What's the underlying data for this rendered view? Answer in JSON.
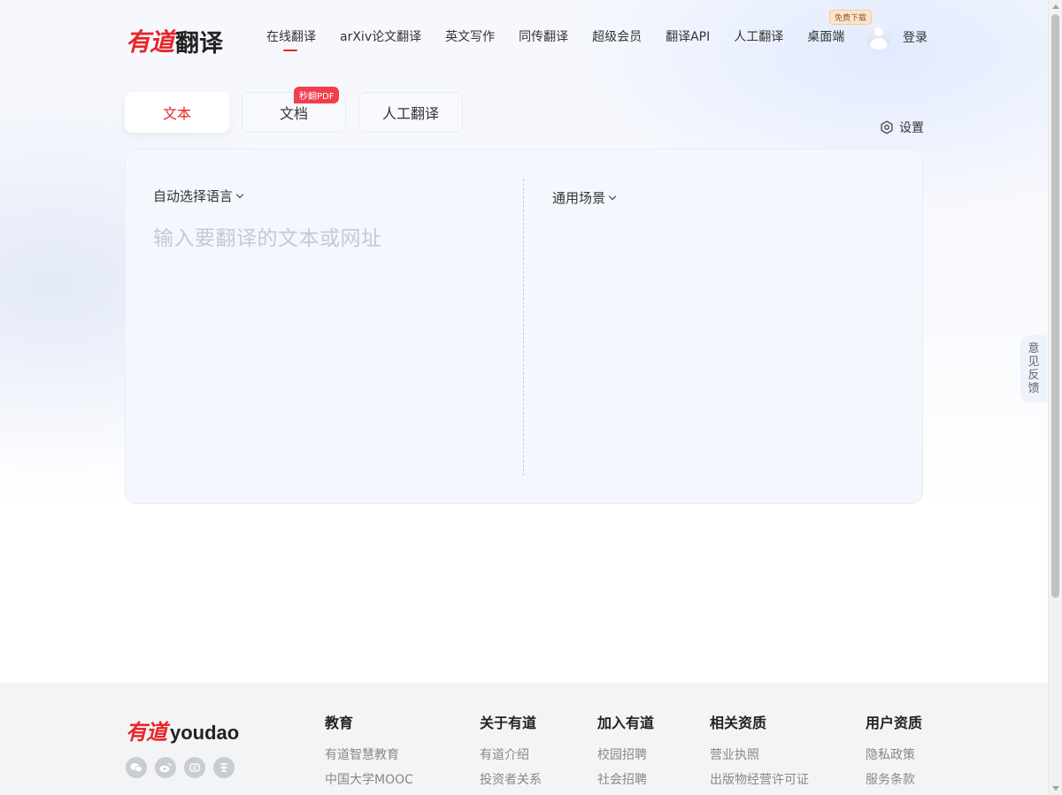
{
  "header": {
    "logo_cn": "有道",
    "logo_title": "翻译",
    "nav": [
      {
        "label": "在线翻译"
      },
      {
        "label": "arXiv论文翻译"
      },
      {
        "label": "英文写作"
      },
      {
        "label": "同传翻译"
      },
      {
        "label": "超级会员"
      },
      {
        "label": "翻译API"
      },
      {
        "label": "人工翻译"
      },
      {
        "label": "桌面端"
      }
    ],
    "desktop_badge": "免费下载",
    "login": "登录"
  },
  "tabs": [
    {
      "label": "文本"
    },
    {
      "label": "文档"
    },
    {
      "label": "人工翻译"
    }
  ],
  "tab_badge": "秒翻PDF",
  "settings_label": "设置",
  "translator": {
    "source_lang": "自动选择语言",
    "scene": "通用场景",
    "placeholder": "输入要翻译的文本或网址"
  },
  "feedback": [
    "意",
    "见",
    "反",
    "馈"
  ],
  "footer": {
    "logo_cn": "有道",
    "logo_en": "youdao",
    "socials": [
      "wechat-icon",
      "weibo-icon",
      "netease-icon",
      "zhihu-icon"
    ],
    "columns": [
      {
        "title": "教育",
        "links": [
          "有道智慧教育",
          "中国大学MOOC"
        ]
      },
      {
        "title": "关于有道",
        "links": [
          "有道介绍",
          "投资者关系"
        ]
      },
      {
        "title": "加入有道",
        "links": [
          "校园招聘",
          "社会招聘"
        ]
      },
      {
        "title": "相关资质",
        "links": [
          "营业执照",
          "出版物经营许可证"
        ]
      },
      {
        "title": "用户资质",
        "links": [
          "隐私政策",
          "服务条款"
        ]
      }
    ]
  },
  "colors": {
    "brand": "#e8262a",
    "panel_bg": "#f4f7fe"
  }
}
